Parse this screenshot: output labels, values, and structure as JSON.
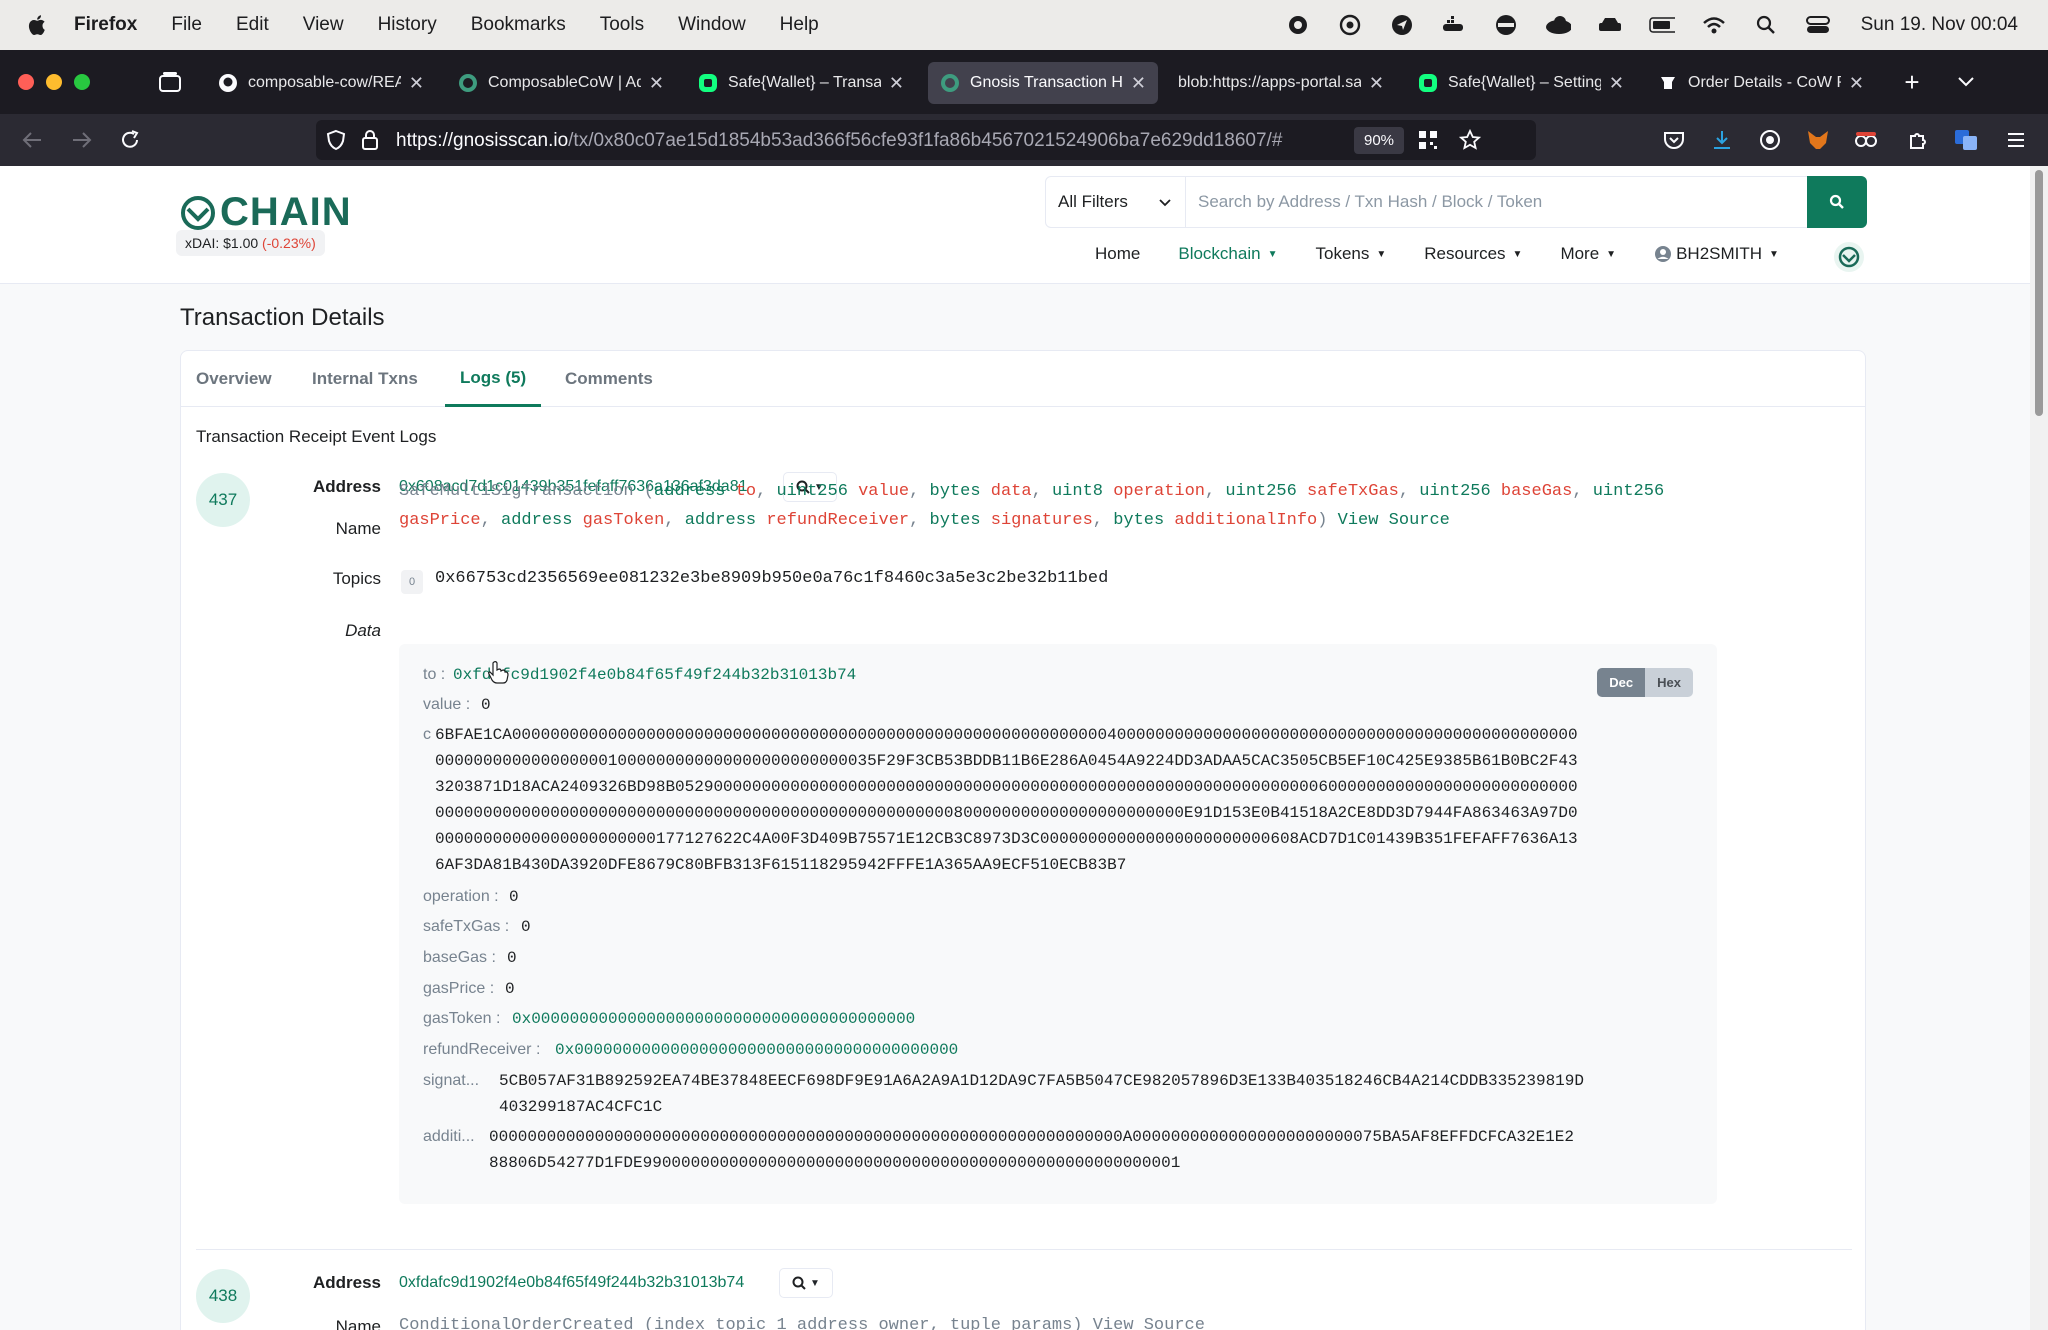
{
  "menubar": {
    "app": "Firefox",
    "items": [
      "File",
      "Edit",
      "View",
      "History",
      "Bookmarks",
      "Tools",
      "Window",
      "Help"
    ],
    "clock": "Sun 19. Nov  00:04"
  },
  "tabs": [
    {
      "label": "composable-cow/READ",
      "icon": "github-icon"
    },
    {
      "label": "ComposableCoW | Add",
      "icon": "gnosis-chain-icon"
    },
    {
      "label": "Safe{Wallet} – Transac",
      "icon": "safe-icon"
    },
    {
      "label": "Gnosis Transaction Ha",
      "icon": "gnosis-chain-icon",
      "active": true
    },
    {
      "label": "blob:https://apps-portal.sa",
      "icon": ""
    },
    {
      "label": "Safe{Wallet} – Setting",
      "icon": "safe-icon"
    },
    {
      "label": "Order Details - CoW P",
      "icon": "cow-icon"
    }
  ],
  "urlbar": {
    "url_host": "https://gnosisscan.io",
    "url_path": "/tx/0x80c07ae15d1854b53ad366f56cfe93f1fa86b4567021524906ba7e629dd18607/#",
    "zoom": "90%"
  },
  "site": {
    "logo_text": "CHAIN",
    "price_label": "xDAI: $1.00",
    "price_change": "(-0.23%)",
    "filter_label": "All Filters",
    "search_placeholder": "Search by Address / Txn Hash / Block / Token",
    "nav": [
      "Home",
      "Blockchain",
      "Tokens",
      "Resources",
      "More",
      "BH2SMITH"
    ],
    "active_nav": "Blockchain"
  },
  "page": {
    "title": "Transaction Details",
    "tabs": [
      "Overview",
      "Internal Txns",
      "Logs (5)",
      "Comments"
    ],
    "active_tab": "Logs (5)",
    "receipt_title": "Transaction Receipt Event Logs"
  },
  "log1": {
    "index": "437",
    "address_label": "Address",
    "address": "0x608acd7d1c01439b351fefaff7636a136af3da81",
    "name_label": "Name",
    "sig": {
      "fn": "SafeMultiSigTransaction",
      "params": [
        {
          "type": "address",
          "name": "to"
        },
        {
          "type": "uint256",
          "name": "value"
        },
        {
          "type": "bytes",
          "name": "data"
        },
        {
          "type": "uint8",
          "name": "operation"
        },
        {
          "type": "uint256",
          "name": "safeTxGas"
        },
        {
          "type": "uint256",
          "name": "baseGas"
        },
        {
          "type": "uint256",
          "name": "gasPrice"
        },
        {
          "type": "address",
          "name": "gasToken"
        },
        {
          "type": "address",
          "name": "refundReceiver"
        },
        {
          "type": "bytes",
          "name": "signatures"
        },
        {
          "type": "bytes",
          "name": "additionalInfo"
        }
      ],
      "view_source": "View Source"
    },
    "topics_label": "Topics",
    "topic_index": "0",
    "topic0": "0x66753cd2356569ee081232e3be8909b950e0a76c1f8460c3a5e3c2be32b11bed",
    "data_label": "Data",
    "dec_label": "Dec",
    "hex_label": "Hex",
    "fields": {
      "to_label": "to :",
      "to": "0xfdafc9d1902f4e0b84f65f49f244b32b31013b74",
      "value_label": "value :",
      "value": "0",
      "data_label": "c",
      "data": "6BFAE1CA0000000000000000000000000000000000000000000000000000000000000040000000000000000000000000000000000000000000000000000000000000000001000000000000000000000000035F29F3CB53BDDB11B6E286A0454A9224DD3ADAA5CAC3505CB5EF10C425E9385B61B0BC2F433203871D18ACA2409326BD98B0529000000000000000000000000000000000000000000000000000000000000000600000000000000000000000000000000000000000000000000000000000000000000000000000000800000000000000000000000E91D153E0B41518A2CE8DD3D7944FA863463A97D000000000000000000000000177127622C4A00F3D409B75571E12CB3C8973D3C000000000000000000000000608ACD7D1C01439B351FEFAFF7636A136AF3DA81B430DA3920DFE8679C80BFB313F615118295942FFFE1A365AA9ECF510ECB83B7",
      "operation_label": "operation :",
      "operation": "0",
      "safeTxGas_label": "safeTxGas :",
      "safeTxGas": "0",
      "baseGas_label": "baseGas :",
      "baseGas": "0",
      "gasPrice_label": "gasPrice :",
      "gasPrice": "0",
      "gasToken_label": "gasToken :",
      "gasToken": "0x0000000000000000000000000000000000000000",
      "refundReceiver_label": "refundReceiver :",
      "refundReceiver": "0x0000000000000000000000000000000000000000",
      "signatures_label": "signat...",
      "signatures": "5CB057AF31B892592EA74BE37848EECF698DF9E91A6A2A9A1D12DA9C7FA5B5047CE982057896D3E133B403518246CB4A214CDDB335239819D403299187AC4CFC1C",
      "additionalInfo_label": "additi...",
      "additionalInfo": "000000000000000000000000000000000000000000000000000000000000000000A00000000000000000000000075BA5AF8EFFDCFCA32E1E288806D54277D1FDE99000000000000000000000000000000000000000000000000000001"
    }
  },
  "log2": {
    "index": "438",
    "address_label": "Address",
    "address": "0xfdafc9d1902f4e0b84f65f49f244b32b31013b74",
    "name_label": "Name",
    "sig_partial": "ConditionalOrderCreated (index_topic_1 address owner, tuple params) View Source"
  },
  "colors": {
    "brand": "#0f7a5c",
    "negative": "#de4437",
    "muted": "#77838f"
  }
}
